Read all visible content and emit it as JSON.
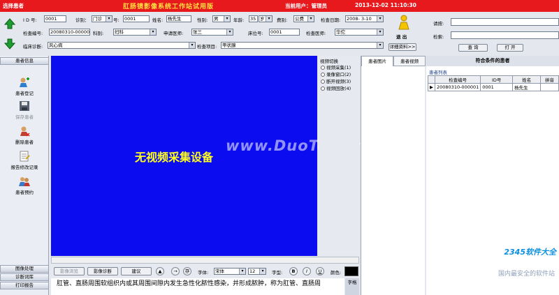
{
  "titlebar": {
    "left": "选择患者",
    "app_title": "肛肠镜影像系统工作站试用版",
    "user": "当前用户：管理员",
    "datetime": "2013-12-02 11:10:30"
  },
  "form": {
    "id_label": "I D 号:",
    "id_value": "0001",
    "clinic_label": "诊别：",
    "clinic_value": "门诊",
    "no_label": "号:",
    "no_value": "0001",
    "name_label": "姓名:",
    "name_value": "杨先生",
    "sex_label": "性别:",
    "sex_value": "男",
    "age_label": "年龄:",
    "age_value": "35",
    "age_unit": "岁",
    "fee_label": "费别:",
    "fee_value": "公费",
    "date_label": "检查日期:",
    "date_value": "2008- 3-10",
    "exam_no_label": "检查编号:",
    "exam_no_value": "20080310-000001",
    "dept_label": "科别:",
    "dept_value": "妇科",
    "req_doctor_label": "申请医师:",
    "req_doctor_value": "张三",
    "bed_label": "床位号:",
    "bed_value": "0001",
    "exam_doctor_label": "检查医师:",
    "exam_doctor_value": "华佗",
    "diagnosis_label": "临床诊断:",
    "diagnosis_value": "风心病",
    "item_label": "检查项目:",
    "item_value": "甲状腺",
    "exit_label": "退  出",
    "detail_btn": "详细资料>>",
    "input_label": "请按:",
    "input_value": "",
    "search_label": "检索:",
    "search_value": "",
    "query_btn": "查  询",
    "open_btn": "打  开"
  },
  "left_panel": {
    "head": "患者信息",
    "items": [
      "患者登记",
      "保存患者",
      "删除患者",
      "报告修改记录",
      "患者预约"
    ],
    "bottom": [
      "图像处理",
      "诊断词库",
      "打印报告"
    ]
  },
  "video": {
    "no_device": "无视频采集设备",
    "switch_title": "视频切换",
    "options": [
      "视频采集(1)",
      "录像窗口(2)",
      "断开视频(3)",
      "视频回放(4)"
    ]
  },
  "toolbar": {
    "img_browse": "影像浏览",
    "img_diag": "影像诊断",
    "suggest": "建议",
    "font_label": "字体:",
    "font_value": "宋体",
    "size_value": "12",
    "style_label": "字型:",
    "bold": "B",
    "italic": "I",
    "underline": "U",
    "color_label": "颜色:",
    "color_value": "#000000"
  },
  "text": {
    "content": "肛管、直肠周围软组织内或其周围间隙内发生急性化脓性感染，并形成脓肿，称为肛管、直肠周",
    "side_btn": "字格"
  },
  "image_tabs": [
    "患者图片",
    "患者视频"
  ],
  "right_panel": {
    "title": "符合条件的患者",
    "subtitle": "患者列表",
    "columns": [
      "检查编号",
      "ID号",
      "姓名",
      "拼音"
    ],
    "rows": [
      [
        "20080310-000001",
        "0001",
        "杨先生",
        ""
      ]
    ]
  },
  "watermark": "www.DuoTe.com",
  "logo": {
    "brand": "2345软件大全",
    "slogan": "国内最安全的软件站"
  }
}
